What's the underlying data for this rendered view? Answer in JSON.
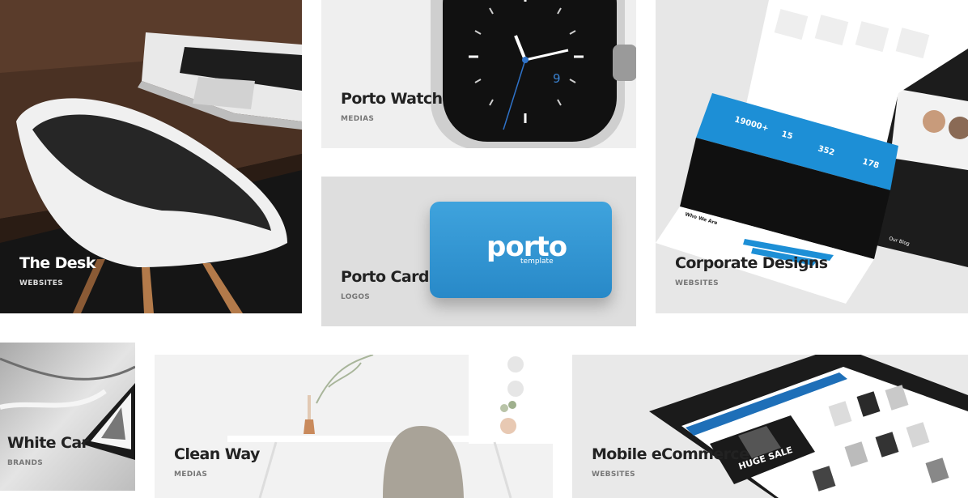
{
  "portfolio": {
    "items": [
      {
        "title": "The Desk",
        "category": "WEBSITES"
      },
      {
        "title": "Porto Watch",
        "category": "MEDIAS"
      },
      {
        "title": "Porto Card",
        "category": "LOGOS"
      },
      {
        "title": "Corporate Designs",
        "category": "WEBSITES"
      },
      {
        "title": "White Car",
        "category": "BRANDS"
      },
      {
        "title": "Clean Way",
        "category": "MEDIAS"
      },
      {
        "title": "Mobile eCommerce",
        "category": "WEBSITES"
      }
    ]
  },
  "card_mockup": {
    "logo": "porto",
    "sub": "template"
  },
  "watch_mockup": {
    "dial_number": "9"
  },
  "corporate_mockup": {
    "stats": [
      "19000+",
      "15",
      "352",
      "178"
    ],
    "section_who": "Who We Are",
    "section_blog": "Our Blog"
  },
  "mobile_mockup": {
    "banner": "HUGE SALE"
  },
  "colors": {
    "accent": "#0088cc",
    "card_blue": "#2f95d3",
    "title_dark": "#222222",
    "category_gray": "#777777"
  }
}
